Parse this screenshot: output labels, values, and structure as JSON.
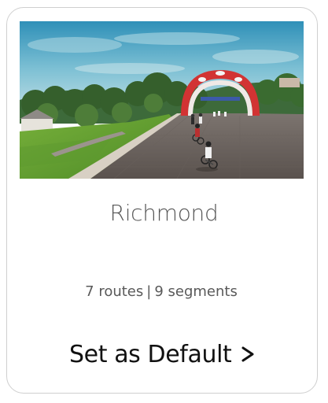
{
  "world": {
    "name": "Richmond",
    "routes": "7 routes",
    "separator": "|",
    "segments": "9 segments",
    "cta_label": "Set as Default",
    "cta_icon": "chevron-right-icon",
    "image_alt": "Richmond course scene with cyclists riding toward a red and white start arch"
  }
}
